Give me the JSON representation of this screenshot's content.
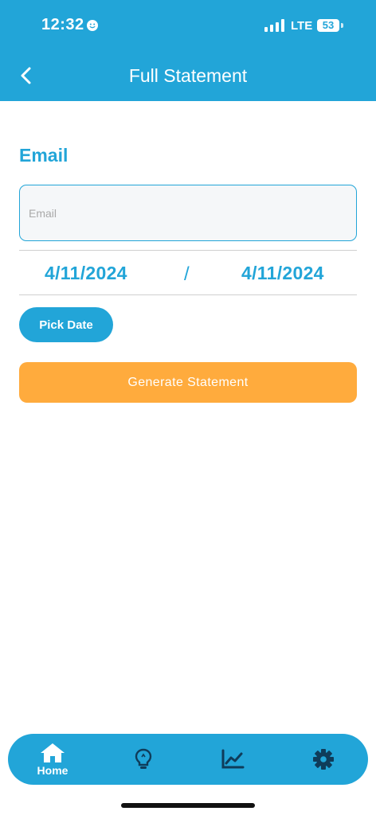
{
  "status_bar": {
    "time": "12:32",
    "network": "LTE",
    "battery": "53"
  },
  "header": {
    "title": "Full Statement",
    "back_icon": "chevron-left-icon"
  },
  "form": {
    "section_label": "Email",
    "email_placeholder": "Email",
    "email_value": "",
    "start_date": "4/11/2024",
    "separator": "/",
    "end_date": "4/11/2024",
    "pick_date_label": "Pick Date",
    "generate_label": "Generate Statement"
  },
  "bottom_nav": {
    "items": [
      {
        "label": "Home",
        "icon": "home-icon"
      },
      {
        "label": "",
        "icon": "lightbulb-icon"
      },
      {
        "label": "",
        "icon": "chart-line-icon"
      },
      {
        "label": "",
        "icon": "gear-icon"
      }
    ]
  },
  "colors": {
    "primary": "#22a5d8",
    "accent": "#ffab3d",
    "nav_icon_dark": "#0f3c5a"
  }
}
